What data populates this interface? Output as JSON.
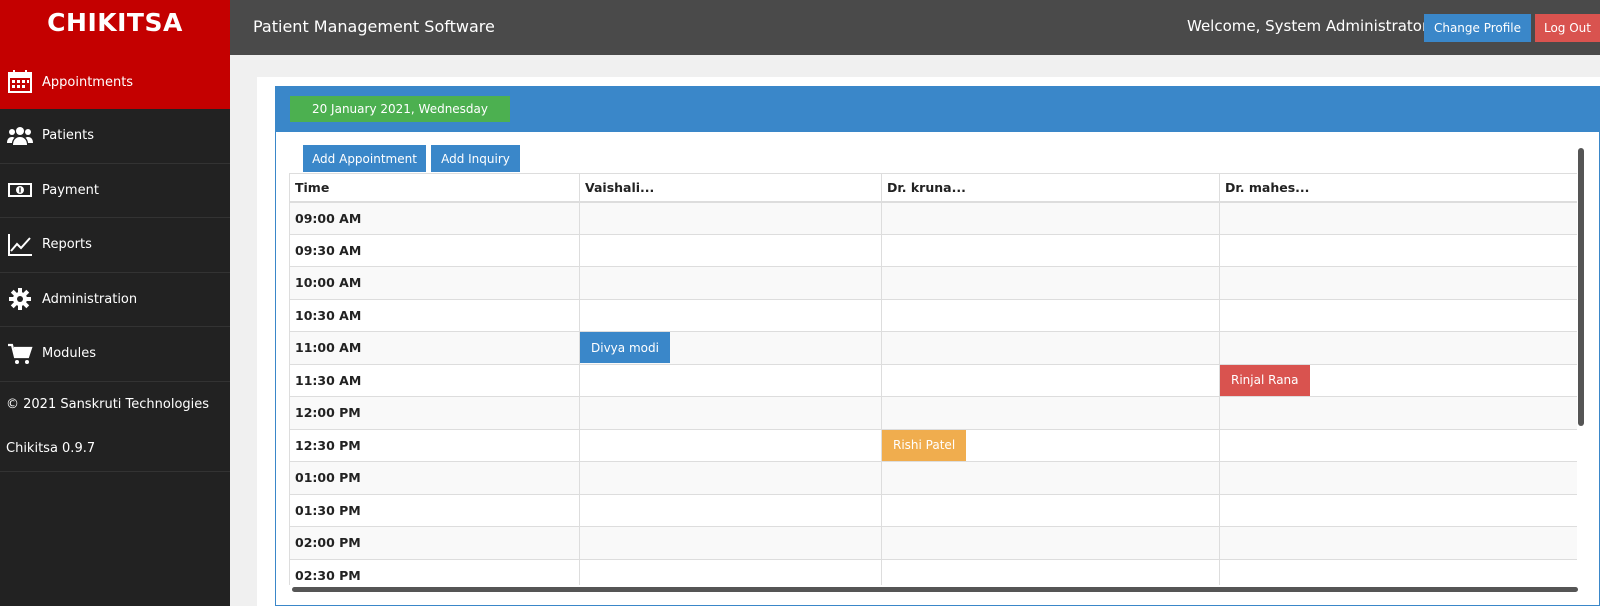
{
  "sidebar": {
    "brand": "CHIKITSA",
    "items": [
      {
        "label": "Appointments",
        "icon": "calendar-icon",
        "active": true
      },
      {
        "label": "Patients",
        "icon": "users-icon"
      },
      {
        "label": "Payment",
        "icon": "money-icon"
      },
      {
        "label": "Reports",
        "icon": "line-chart-icon"
      },
      {
        "label": "Administration",
        "icon": "gear-icon"
      },
      {
        "label": "Modules",
        "icon": "cart-icon"
      }
    ],
    "copyright": "© 2021 Sanskruti Technologies",
    "version": "Chikitsa 0.9.7"
  },
  "header": {
    "title": "Patient Management Software",
    "welcome": "Welcome, System Administrator",
    "change_profile": "Change Profile",
    "logout": "Log Out"
  },
  "panel": {
    "date": "20 January 2021, Wednesday",
    "add_appointment": "Add Appointment",
    "add_inquiry": "Add Inquiry"
  },
  "schedule": {
    "columns": [
      "Time",
      "Vaishali...",
      "Dr. kruna...",
      "Dr. mahes..."
    ],
    "times": [
      "09:00 AM",
      "09:30 AM",
      "10:00 AM",
      "10:30 AM",
      "11:00 AM",
      "11:30 AM",
      "12:00 PM",
      "12:30 PM",
      "01:00 PM",
      "01:30 PM",
      "02:00 PM",
      "02:30 PM"
    ],
    "appointments": [
      {
        "time": "11:00 AM",
        "doctor": "Vaishali...",
        "patient": "Divya modi",
        "color": "#3a87c9"
      },
      {
        "time": "11:30 AM",
        "doctor": "Dr. mahes...",
        "patient": "Rinjal Rana",
        "color": "#d9534f"
      },
      {
        "time": "12:30 PM",
        "doctor": "Dr. kruna...",
        "patient": "Rishi Patel",
        "color": "#f0ad4e"
      }
    ]
  },
  "colors": {
    "brand_red": "#c40000",
    "primary_blue": "#3a87c9",
    "success_green": "#4cb050",
    "danger_red": "#d9534f",
    "warning_orange": "#f0ad4e"
  }
}
